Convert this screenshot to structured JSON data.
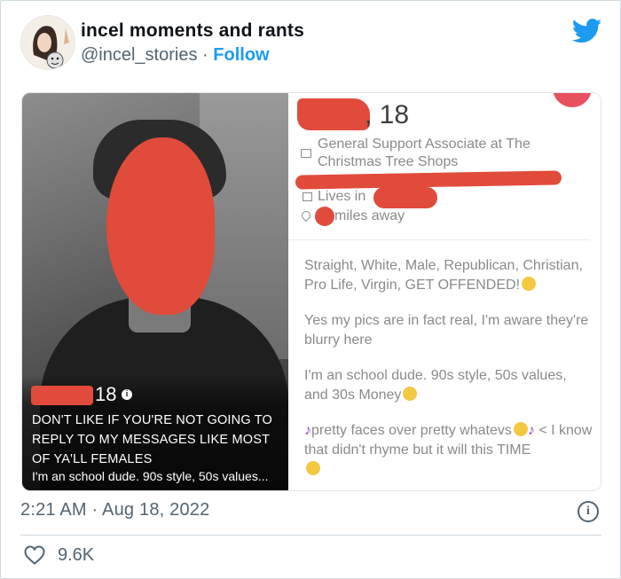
{
  "author": {
    "display_name": "incel moments and rants",
    "handle": "@incel_stories",
    "separator": "·",
    "follow_label": "Follow"
  },
  "media": {
    "photo": {
      "age": "18",
      "info_glyph": "i",
      "caption": "DON'T LIKE IF YOU'RE NOT GOING TO REPLY TO MY MESSAGES LIKE MOST OF YA'LL FEMALES",
      "bio_preview": "I'm an school dude. 90s style, 50s values..."
    },
    "profile": {
      "age_suffix": ", 18",
      "job": "General Support Associate at The Christmas Tree Shops",
      "lives_in": "Lives in",
      "distance": "miles away",
      "bio_1": "Straight, White, Male, Republican, Christian, Pro Life, Virgin, GET OFFENDED!",
      "bio_2": "Yes my pics are in fact real, I'm aware they're blurry here",
      "bio_3": "I'm an school dude. 90s style, 50s values, and 30s Money",
      "bio_4_note": "♪",
      "bio_4a": "pretty faces over pretty whatevs",
      "bio_4b": " < I know that didn't rhyme but it will this TIME"
    }
  },
  "timestamp": "2:21 AM · Aug 18, 2022",
  "info_glyph": "i",
  "likes": "9.6K",
  "colors": {
    "accent": "#1d9bf0",
    "redaction": "#e14b3b",
    "muted": "#536471"
  }
}
